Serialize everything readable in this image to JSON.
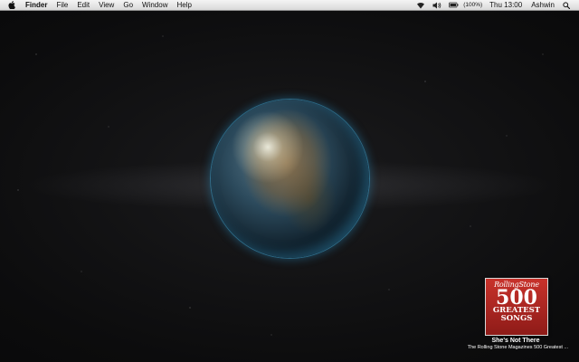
{
  "menubar": {
    "app_name": "Finder",
    "menus": [
      "File",
      "Edit",
      "View",
      "Go",
      "Window",
      "Help"
    ],
    "battery_text": "(100%)",
    "clock": "Thu 13:00",
    "user": "Ashwin"
  },
  "icons": {
    "apple": "apple-icon",
    "wifi": "wifi-icon",
    "volume": "volume-icon",
    "battery": "battery-icon",
    "spotlight": "search-icon"
  },
  "now_playing": {
    "cover_magazine": "RollingStone",
    "cover_number": "500",
    "cover_line1": "GREATEST",
    "cover_line2": "SONGS",
    "title": "She's Not There",
    "album": "The Rolling Stone Magazines 500 Greatest ..."
  },
  "colors": {
    "background": "#0b0b0c",
    "menubar": "#e6e6e6",
    "globe_glow": "#2e8fc0",
    "cover_red": "#b52a24"
  }
}
